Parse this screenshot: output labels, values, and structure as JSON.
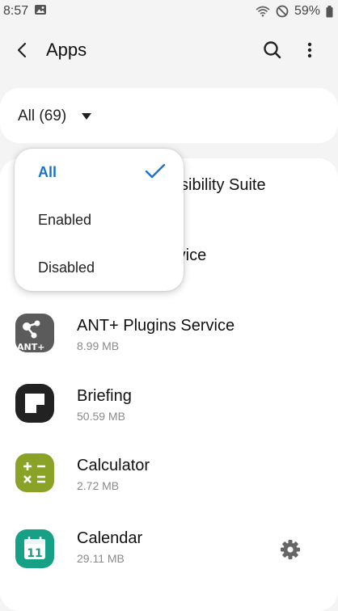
{
  "status_bar": {
    "time": "8:57",
    "battery": "59%"
  },
  "header": {
    "title": "Apps"
  },
  "filter": {
    "label": "All (69)"
  },
  "dropdown": {
    "options": [
      {
        "label": "All",
        "selected": true
      },
      {
        "label": "Enabled",
        "selected": false
      },
      {
        "label": "Disabled",
        "selected": false
      }
    ]
  },
  "list": {
    "partial_items": [
      "ssibility Suite",
      "rvice"
    ],
    "apps": [
      {
        "name": "ANT+ Plugins Service",
        "size": "8.99 MB",
        "icon": "ant-plus-icon"
      },
      {
        "name": "Briefing",
        "size": "50.59 MB",
        "icon": "briefing-icon"
      },
      {
        "name": "Calculator",
        "size": "2.72 MB",
        "icon": "calculator-icon"
      },
      {
        "name": "Calendar",
        "size": "29.11 MB",
        "icon": "calendar-icon",
        "calendar_day": "11"
      }
    ]
  },
  "colors": {
    "accent": "#1a73c9",
    "ant_icon": "#5b5b5b",
    "briefing_icon": "#222222",
    "calculator_icon": "#8aa326",
    "calendar_icon": "#16a085"
  }
}
